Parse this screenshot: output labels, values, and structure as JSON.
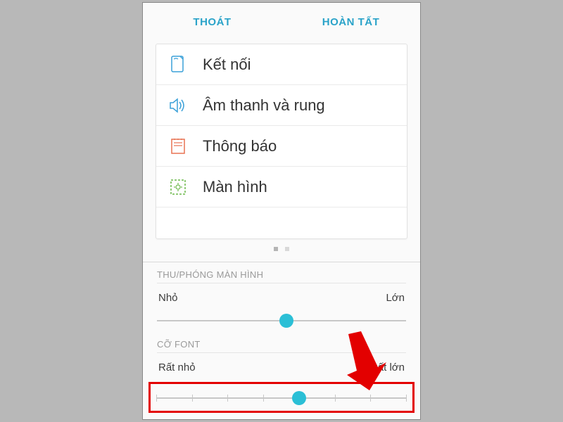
{
  "top_bar": {
    "left_label": "THOÁT",
    "right_label": "HOÀN TẤT"
  },
  "settings_preview": {
    "rows": [
      {
        "icon": "device-icon",
        "label": "Kết nối"
      },
      {
        "icon": "sound-icon",
        "label": "Âm thanh và rung"
      },
      {
        "icon": "notification-icon",
        "label": "Thông báo"
      },
      {
        "icon": "display-icon",
        "label": "Màn hình"
      }
    ]
  },
  "zoom_section": {
    "title": "THU/PHÓNG MÀN HÌNH",
    "min_label": "Nhỏ",
    "max_label": "Lớn",
    "value_percent": 52
  },
  "font_section": {
    "title": "CỠ FONT",
    "min_label": "Rất nhỏ",
    "max_label": "Rất lớn",
    "ticks": 8,
    "value_index": 4
  },
  "colors": {
    "accent": "#2aa3c9",
    "slider_thumb": "#2bbfd6",
    "highlight": "#e30000"
  }
}
